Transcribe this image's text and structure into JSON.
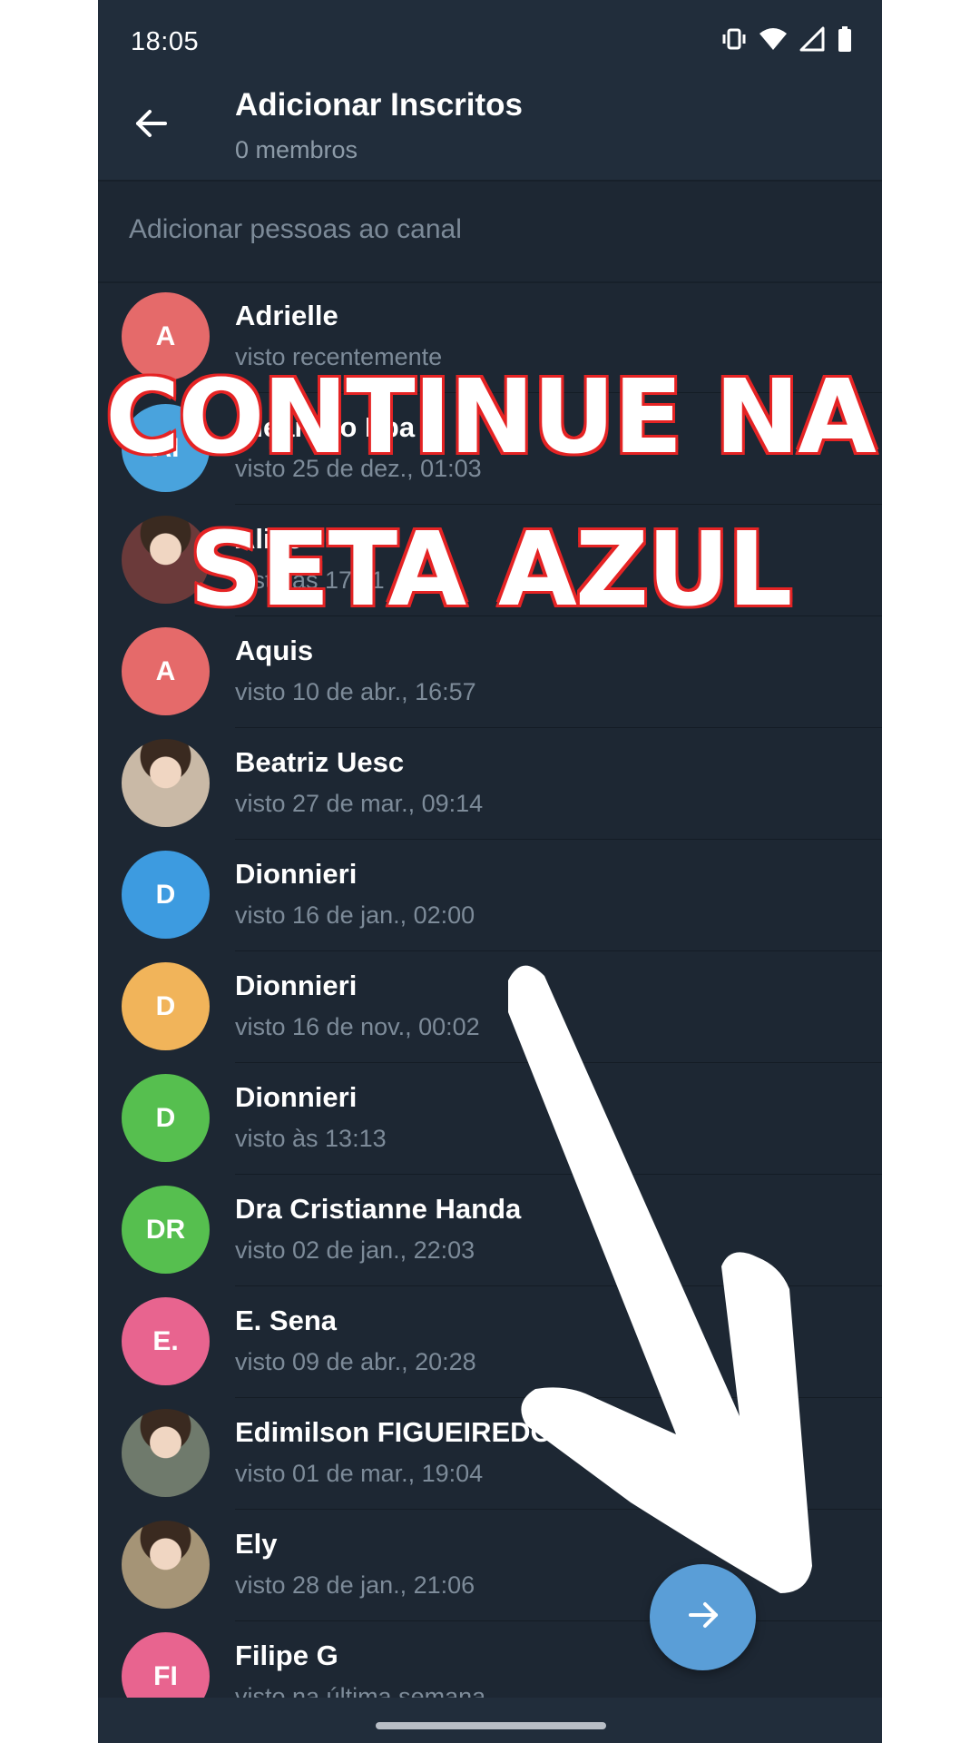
{
  "status_bar": {
    "time": "18:05",
    "icons": [
      "vibrate-icon",
      "wifi-icon",
      "signal-icon",
      "battery-icon"
    ]
  },
  "app_bar": {
    "title": "Adicionar Inscritos",
    "subtitle": "0 membros",
    "back_icon": "arrow-left-icon"
  },
  "search": {
    "placeholder": "Adicionar pessoas ao canal"
  },
  "contacts": [
    {
      "name": "Adrielle",
      "status": "visto recentemente",
      "initials": "A",
      "color": "#e56a6a",
      "photo": false
    },
    {
      "name": "Aleandro Ifba",
      "status": "visto 25 de dez., 01:03",
      "initials": "AI",
      "color": "#49a3dd",
      "photo": false
    },
    {
      "name": "Alice",
      "status": "visto às 17:11",
      "initials": "",
      "color": "#6b3a3a",
      "photo": true
    },
    {
      "name": "Aquis",
      "status": "visto 10 de abr., 16:57",
      "initials": "A",
      "color": "#e56a6a",
      "photo": false
    },
    {
      "name": "Beatriz Uesc",
      "status": "visto 27 de mar., 09:14",
      "initials": "",
      "color": "#c9b9a6",
      "photo": true
    },
    {
      "name": "Dionnieri",
      "status": "visto 16 de jan., 02:00",
      "initials": "D",
      "color": "#3d9be0",
      "photo": false
    },
    {
      "name": "Dionnieri",
      "status": "visto 16 de nov., 00:02",
      "initials": "D",
      "color": "#f1b45a",
      "photo": false
    },
    {
      "name": "Dionnieri",
      "status": "visto às 13:13",
      "initials": "D",
      "color": "#56bf4f",
      "photo": false
    },
    {
      "name": "Dra Cristianne Handa",
      "status": "visto 02 de jan., 22:03",
      "initials": "DR",
      "color": "#56bf4f",
      "photo": false
    },
    {
      "name": "E. Sena",
      "status": "visto 09 de abr., 20:28",
      "initials": "E.",
      "color": "#e8648f",
      "photo": false
    },
    {
      "name": "Edimilson FIGUEIREDO",
      "status": "visto 01 de mar., 19:04",
      "initials": "",
      "color": "#6f7a6c",
      "photo": true
    },
    {
      "name": "Ely",
      "status": "visto 28 de jan., 21:06",
      "initials": "",
      "color": "#a59476",
      "photo": true
    },
    {
      "name": "Filipe G",
      "status": "visto na última semana",
      "initials": "FI",
      "color": "#e8648f",
      "photo": false
    }
  ],
  "fab": {
    "icon": "arrow-right-icon",
    "color": "#5a9ed7"
  },
  "overlay": {
    "line1": "CONTINUE NA",
    "line2": "SETA AZUL",
    "text_color": "#ffffff",
    "outline_color": "#e52425",
    "arrow_color": "#ffffff"
  }
}
